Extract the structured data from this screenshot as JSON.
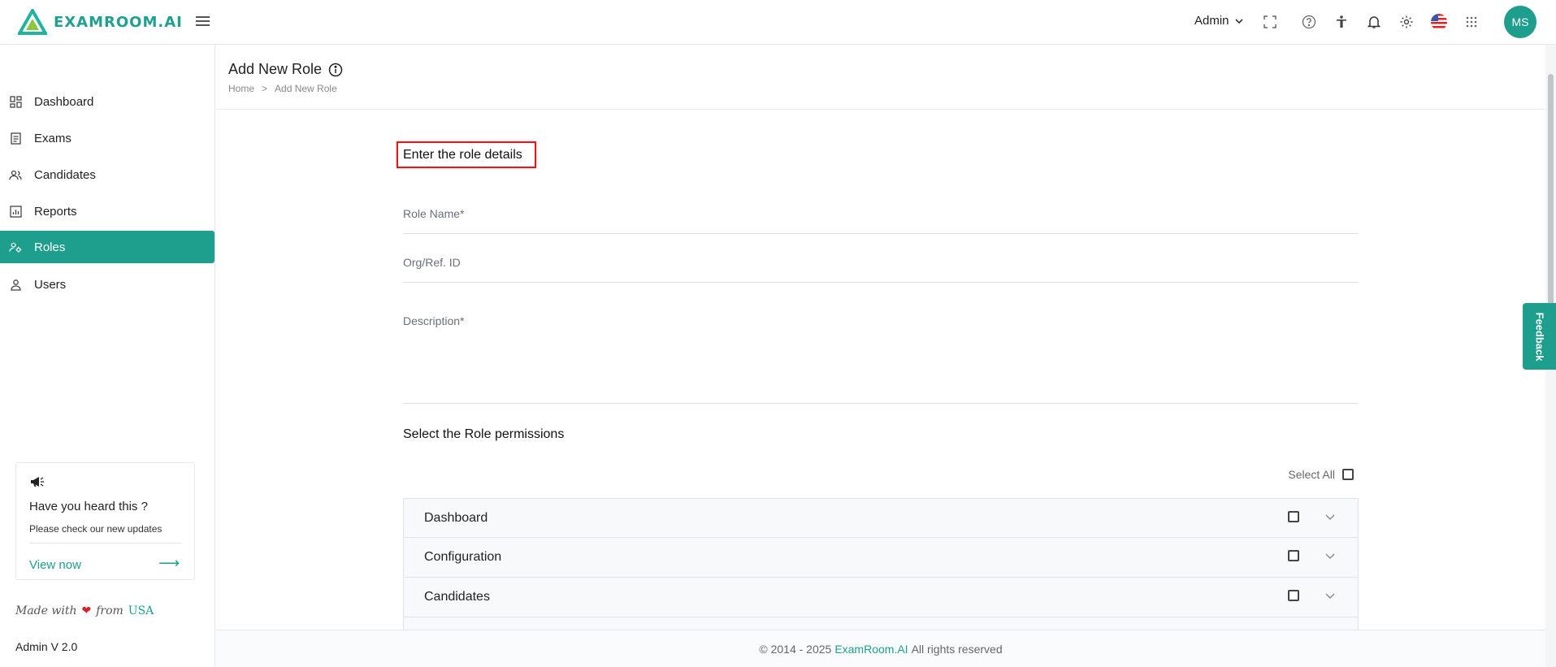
{
  "topbar": {
    "logo_text": "EXAMROOM.AI",
    "role_dropdown": "Admin",
    "avatar_initials": "MS"
  },
  "sidebar": {
    "items": [
      {
        "label": "Dashboard",
        "icon": "dashboard-icon"
      },
      {
        "label": "Exams",
        "icon": "exams-icon"
      },
      {
        "label": "Candidates",
        "icon": "candidates-icon"
      },
      {
        "label": "Reports",
        "icon": "reports-icon"
      },
      {
        "label": "Roles",
        "icon": "roles-icon",
        "active": true
      },
      {
        "label": "Users",
        "icon": "users-icon"
      }
    ],
    "promo": {
      "title": "Have you heard this ?",
      "subtitle": "Please check our new updates",
      "link": "View now"
    },
    "made_with": "Made with",
    "made_from": "from",
    "made_country": "USA",
    "version": "Admin V 2.0"
  },
  "header": {
    "title": "Add New Role",
    "breadcrumb": [
      "Home",
      ">",
      "Add New Role"
    ]
  },
  "form": {
    "section_title": "Enter the role details",
    "role_name_placeholder": "Role Name*",
    "org_ref_placeholder": "Org/Ref. ID",
    "description_placeholder": "Description*",
    "permissions_title": "Select the Role permissions",
    "select_all_label": "Select All",
    "permissions": [
      "Dashboard",
      "Configuration",
      "Candidates"
    ]
  },
  "footer": {
    "prefix": "© 2014 - 2025",
    "brand": "ExamRoom.AI",
    "suffix": "All rights reserved"
  },
  "feedback_label": "Feedback",
  "colors": {
    "accent": "#1e9e8c",
    "highlight_border": "#e01a1a"
  }
}
